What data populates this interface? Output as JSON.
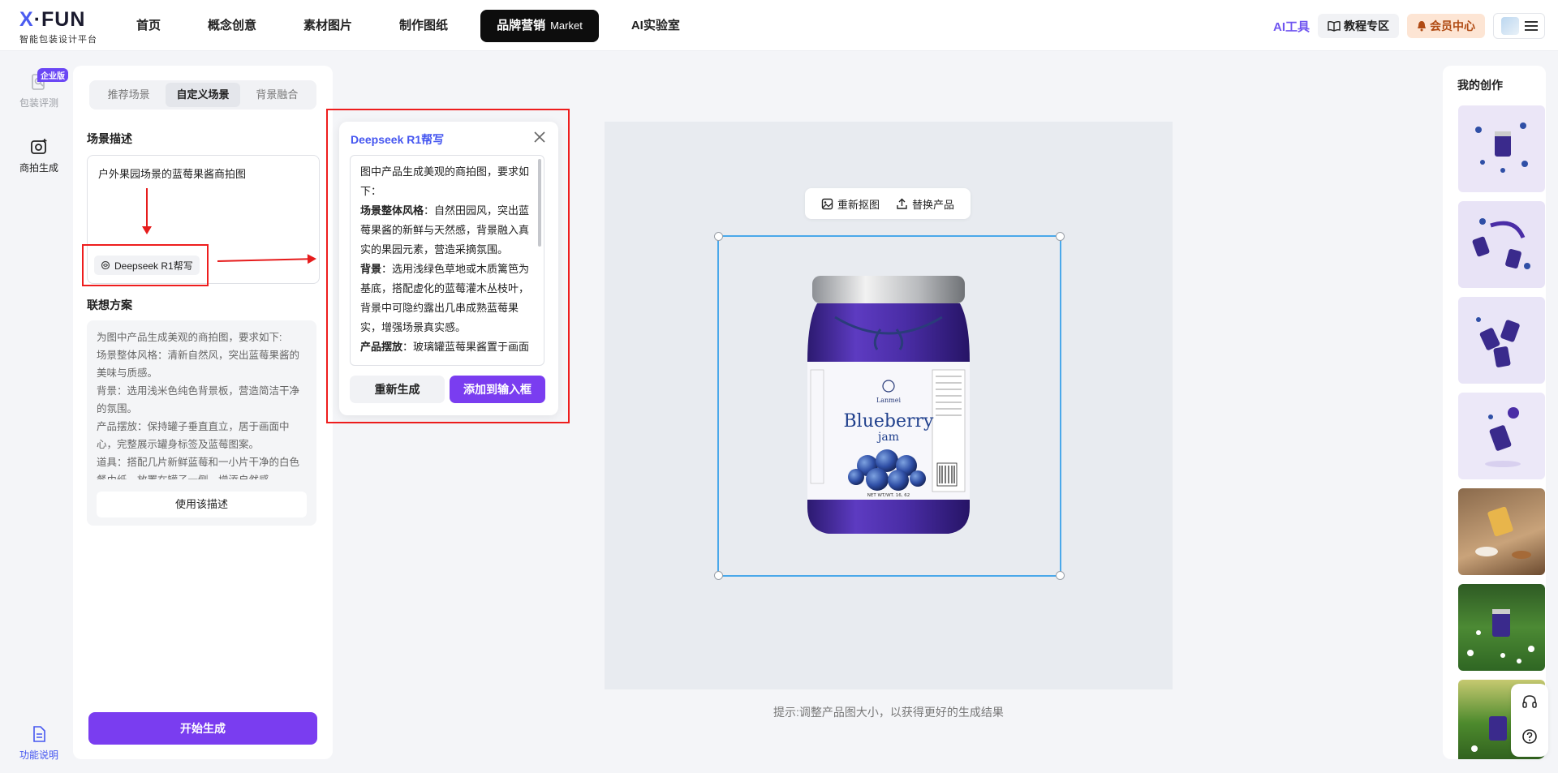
{
  "logo": {
    "brand_x": "X",
    "brand_rest": "·FUN",
    "tagline": "智能包装设计平台"
  },
  "nav": {
    "items": [
      {
        "label": "首页"
      },
      {
        "label": "概念创意"
      },
      {
        "label": "素材图片"
      },
      {
        "label": "制作图纸"
      },
      {
        "label": "品牌营销",
        "tag": "Market",
        "active": true
      },
      {
        "label": "AI实验室"
      }
    ]
  },
  "header_right": {
    "ai_tools": "AI工具",
    "tutorial": "教程专区",
    "member": "会员中心"
  },
  "rail": {
    "items": [
      {
        "label": "包装评测",
        "badge": "企业版"
      },
      {
        "label": "商拍生成"
      }
    ],
    "help": "功能说明"
  },
  "left_panel": {
    "tabs": [
      {
        "label": "推荐场景"
      },
      {
        "label": "自定义场景",
        "active": true
      },
      {
        "label": "背景融合"
      }
    ],
    "scene_title": "场景描述",
    "scene_value": "户外果园场景的蓝莓果酱商拍图",
    "deepseek_button": "Deepseek R1帮写",
    "plan_title": "联想方案",
    "plan_text": "为图中产品生成美观的商拍图，要求如下:\n场景整体风格：清新自然风，突出蓝莓果酱的美味与质感。\n背景：选用浅米色纯色背景板，营造简洁干净的氛围。\n产品摆放：保持罐子垂直直立，居于画面中心，完整展示罐身标签及蓝莓图案。\n道具：搭配几片新鲜蓝莓和一小片干净的白色餐巾纸，放置在罐子一侧，增添自然感…",
    "use_button": "使用该描述",
    "start_button": "开始生成"
  },
  "deepseek_popup": {
    "title": "Deepseek R1帮写",
    "intro": "图中产品生成美观的商拍图，要求如下：",
    "style_label": "场景整体风格",
    "style_text": "：自然田园风，突出蓝莓果酱的新鲜与天然感，背景融入真实的果园元素，营造采摘氛围。",
    "bg_label": "背景",
    "bg_text": "：选用浅绿色草地或木质篱笆为基底，搭配虚化的蓝莓灌木丛枝叶，背景中可隐约露出几串成熟蓝莓果实，增强场景真实感。",
    "place_label": "产品摆放",
    "place_text": "：玻璃罐蓝莓果酱置于画面",
    "regen_button": "重新生成",
    "add_button": "添加到输入框"
  },
  "canvas": {
    "rematting": "重新抠图",
    "replace": "替换产品",
    "hint": "提示:调整产品图大小，以获得更好的生成结果",
    "jar": {
      "brand": "Lanmei",
      "name": "Blueberry",
      "sub": "jam",
      "net": "NET WT/WT. 16, 62",
      "nutrition": "Nutrition Facts"
    }
  },
  "right_panel": {
    "title": "我的创作"
  },
  "colors": {
    "accent": "#7a3df0",
    "deepseek_blue": "#4556f0",
    "annotation_red": "#ee1d1d",
    "selection_blue": "#4aa8ea"
  }
}
